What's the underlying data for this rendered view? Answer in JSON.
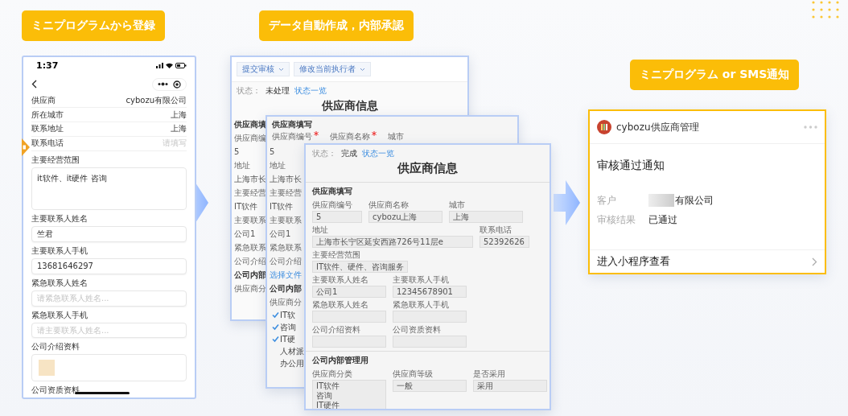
{
  "steps": [
    {
      "label": "ミニプログラムから登録"
    },
    {
      "label": "データ自動作成，内部承認"
    },
    {
      "label": "ミニプログラム or SMS通知"
    }
  ],
  "phone": {
    "time": "1:37",
    "rows": [
      {
        "label": "供应商",
        "value": "cybozu有限公司"
      },
      {
        "label": "所在城市",
        "value": "上海"
      },
      {
        "label": "联系地址",
        "value": "上海"
      },
      {
        "label": "联系电话",
        "placeholder": "请填写"
      }
    ],
    "fields": [
      {
        "kind": "textarea",
        "label": "主要经营范围",
        "value": "it软件、it硬件 咨询"
      },
      {
        "kind": "input",
        "label": "主要联系人姓名",
        "value": "竺君"
      },
      {
        "kind": "input",
        "label": "主要联系人手机",
        "value": "13681646297"
      },
      {
        "kind": "input",
        "label": "紧急联系人姓名",
        "placeholder": "请紧急联系人姓名..."
      },
      {
        "kind": "input",
        "label": "紧急联系人手机",
        "placeholder": "请主要联系人姓名..."
      },
      {
        "kind": "upload",
        "label": "公司介绍资料"
      },
      {
        "kind": "label",
        "label": "公司资质资料"
      }
    ]
  },
  "back_window": {
    "toolbar": [
      "提交审核",
      "修改当前执行者"
    ],
    "status_label": "状态：",
    "status": "未处理",
    "status_link": "状态一览",
    "title": "供应商信息",
    "strip": [
      {
        "kind": "heading",
        "text": "供应商填"
      },
      {
        "kind": "label",
        "text": "供应商编"
      },
      {
        "kind": "value",
        "text": "5"
      },
      {
        "kind": "label",
        "text": "地址"
      },
      {
        "kind": "value",
        "text": "上海市长"
      },
      {
        "kind": "label",
        "text": "主要经营"
      },
      {
        "kind": "value",
        "text": "IT软件"
      },
      {
        "kind": "label",
        "text": "主要联系"
      },
      {
        "kind": "value",
        "text": "公司1"
      },
      {
        "kind": "label",
        "text": "紧急联系"
      },
      {
        "kind": "label",
        "text": "公司介绍"
      },
      {
        "kind": "heading",
        "text": "公司内部"
      },
      {
        "kind": "label",
        "text": "供应商分"
      }
    ]
  },
  "middle_window": {
    "section": "供应商填写",
    "header_fields": [
      {
        "label": "供应商编号",
        "required": true
      },
      {
        "label": "供应商名称",
        "required": true
      },
      {
        "label": "城市",
        "required": false
      }
    ],
    "strip": [
      {
        "kind": "value",
        "text": "5"
      },
      {
        "kind": "label",
        "text": "地址"
      },
      {
        "kind": "value",
        "text": "上海市长"
      },
      {
        "kind": "label",
        "text": "主要经营"
      },
      {
        "kind": "value",
        "text": "IT软件"
      },
      {
        "kind": "label",
        "text": "主要联系"
      },
      {
        "kind": "value",
        "text": "公司1"
      },
      {
        "kind": "label",
        "text": "紧急联系"
      },
      {
        "kind": "label",
        "text": "公司介绍"
      },
      {
        "kind": "link",
        "text": "选择文件"
      },
      {
        "kind": "heading",
        "text": "公司内部"
      },
      {
        "kind": "label",
        "text": "供应商分"
      }
    ],
    "checks": [
      {
        "label": "IT软",
        "checked": true
      },
      {
        "label": "咨询",
        "checked": true
      },
      {
        "label": "IT硬",
        "checked": true
      },
      {
        "label": "人材派",
        "checked": false
      },
      {
        "label": "办公用",
        "checked": false
      }
    ]
  },
  "front_window": {
    "status_label": "状态：",
    "status": "完成",
    "status_link": "状态一览",
    "title": "供应商信息",
    "sections": [
      {
        "heading": "供应商填写",
        "rows": [
          [
            {
              "kind": "short",
              "label": "供应商编号",
              "value": "5"
            },
            {
              "kind": "medium",
              "label": "供应商名称",
              "value": "cybozu上海"
            },
            {
              "kind": "medium",
              "label": "城市",
              "value": "上海"
            }
          ],
          [
            {
              "kind": "wide",
              "label": "地址",
              "value": "上海市长宁区延安西路726号11层e"
            },
            {
              "kind": "short",
              "label": "联系电话",
              "value": "52392626"
            }
          ],
          [
            {
              "kind": "medium",
              "label": "主要经营范围",
              "value": "IT软件、硬件、咨询服务"
            }
          ],
          [
            {
              "kind": "medium",
              "label": "主要联系人姓名",
              "value": "公司1"
            },
            {
              "kind": "medium",
              "label": "主要联系人手机",
              "value": "12345678901"
            }
          ],
          [
            {
              "kind": "medium",
              "label": "紧急联系人姓名"
            },
            {
              "kind": "medium",
              "label": "紧急联系人手机"
            }
          ],
          [
            {
              "kind": "medium",
              "label": "公司介绍资料"
            },
            {
              "kind": "medium",
              "label": "公司资质资料"
            }
          ]
        ]
      },
      {
        "heading": "公司内部管理用",
        "rows": [
          [
            {
              "kind": "multiline",
              "label": "供应商分类",
              "lines": [
                "IT软件",
                "咨询",
                "IT硬件"
              ]
            },
            {
              "kind": "medium",
              "label": "供应商等级",
              "value": "一般"
            },
            {
              "kind": "medium",
              "label": "是否采用",
              "value": "采用"
            }
          ]
        ]
      }
    ]
  },
  "notification": {
    "app_name": "cybozu供应商管理",
    "title": "审核通过通知",
    "rows": [
      {
        "label": "客户",
        "value": "有限公司",
        "redacted": true
      },
      {
        "label": "审核结果",
        "value": "已通过",
        "redacted": false
      }
    ],
    "footer": "进入小程序查看"
  }
}
